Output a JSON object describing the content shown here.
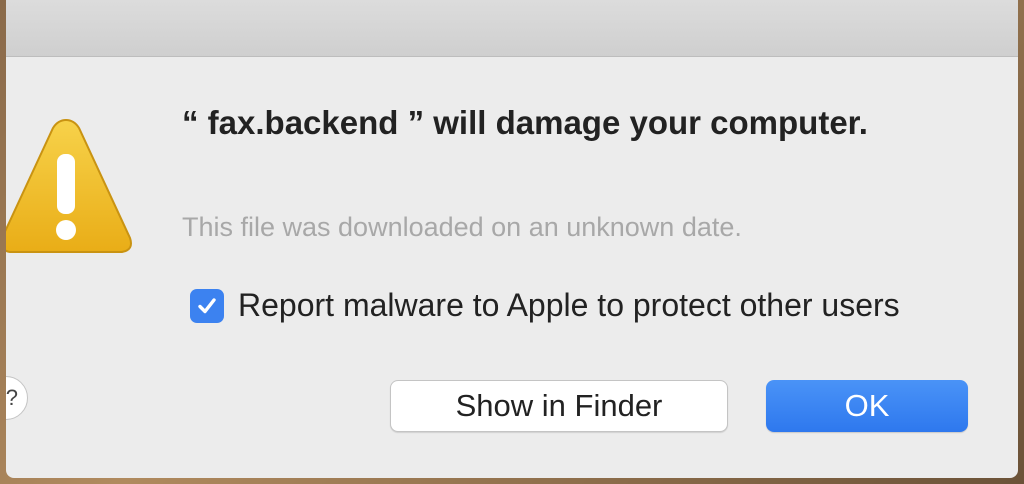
{
  "dialog": {
    "headline": "“ fax.backend ” will damage your computer.",
    "subtext": "This file was downloaded on an unknown date.",
    "checkbox": {
      "label": "Report malware to Apple to protect other users",
      "checked": true
    },
    "buttons": {
      "show_in_finder": "Show in Finder",
      "ok": "OK"
    },
    "help_glyph": "?"
  },
  "icons": {
    "warning": "warning-triangle-icon",
    "checkmark": "checkmark-icon"
  },
  "colors": {
    "accent": "#3c82f0",
    "warning_yellow": "#f2c12e",
    "dialog_bg": "#ececec"
  }
}
